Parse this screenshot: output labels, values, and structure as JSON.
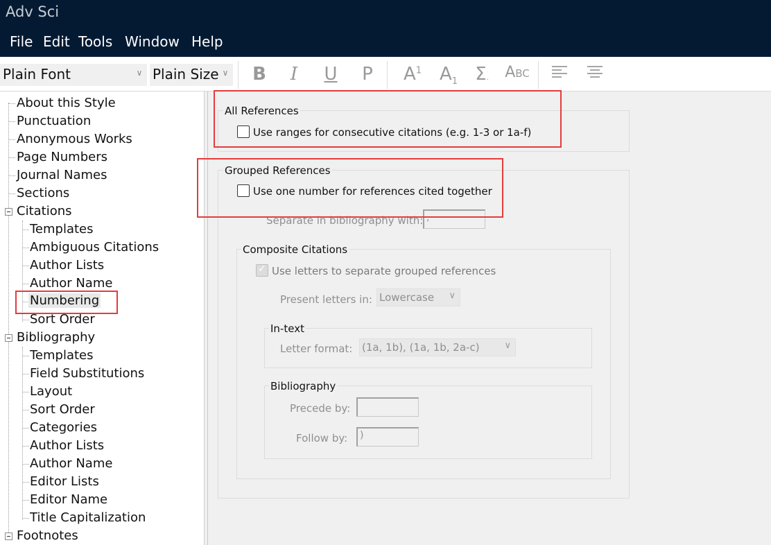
{
  "app": {
    "title": "Adv Sci"
  },
  "menu": [
    "File",
    "Edit",
    "Tools",
    "Window",
    "Help"
  ],
  "toolbar": {
    "font_value": "Plain Font",
    "size_value": "Plain Size",
    "buttons": [
      {
        "icon": "bold-icon",
        "label": "B"
      },
      {
        "icon": "italic-icon",
        "label": "I"
      },
      {
        "icon": "underline-icon",
        "label": "U"
      },
      {
        "icon": "plain-text-icon",
        "label": "P"
      },
      {
        "icon": "superscript-icon",
        "label": "A1"
      },
      {
        "icon": "subscript-icon",
        "label": "A1"
      },
      {
        "icon": "symbol-icon",
        "label": "Σ"
      },
      {
        "icon": "small-caps-icon",
        "label": "ABC"
      },
      {
        "icon": "align-left-icon",
        "label": ""
      },
      {
        "icon": "align-center-icon",
        "label": ""
      }
    ]
  },
  "tree": {
    "items": [
      "About this Style",
      "Punctuation",
      "Anonymous Works",
      "Page Numbers",
      "Journal Names",
      "Sections",
      "Citations",
      "Templates",
      "Ambiguous Citations",
      "Author Lists",
      "Author Name",
      "Numbering",
      "Sort Order",
      "Bibliography",
      "Templates",
      "Field Substitutions",
      "Layout",
      "Sort Order",
      "Categories",
      "Author Lists",
      "Author Name",
      "Editor Lists",
      "Editor Name",
      "Title Capitalization",
      "Footnotes"
    ],
    "selected": "Numbering"
  },
  "panel": {
    "all_refs": {
      "legend": "All References",
      "checkbox_label": "Use ranges for consecutive citations (e.g. 1-3 or 1a-f)",
      "checked": false
    },
    "grouped": {
      "legend": "Grouped References",
      "checkbox_label": "Use one number for references cited together",
      "checked": false,
      "separate_label": "Separate in bibliography with:",
      "separate_value": ","
    },
    "composite": {
      "legend": "Composite Citations",
      "checkbox_label": "Use letters to separate grouped references",
      "checked": true,
      "present_label": "Present letters in:",
      "present_value": "Lowercase",
      "intext": {
        "legend": "In-text",
        "letter_format_label": "Letter format:",
        "letter_format_value": "(1a, 1b), (1a, 1b, 2a-c)"
      },
      "bibliography": {
        "legend": "Bibliography",
        "precede_label": "Precede by:",
        "precede_value": "",
        "follow_label": "Follow by:",
        "follow_value": ")"
      }
    }
  },
  "colors": {
    "titlebar": "#041a33",
    "highlight": "#e53b3b"
  }
}
